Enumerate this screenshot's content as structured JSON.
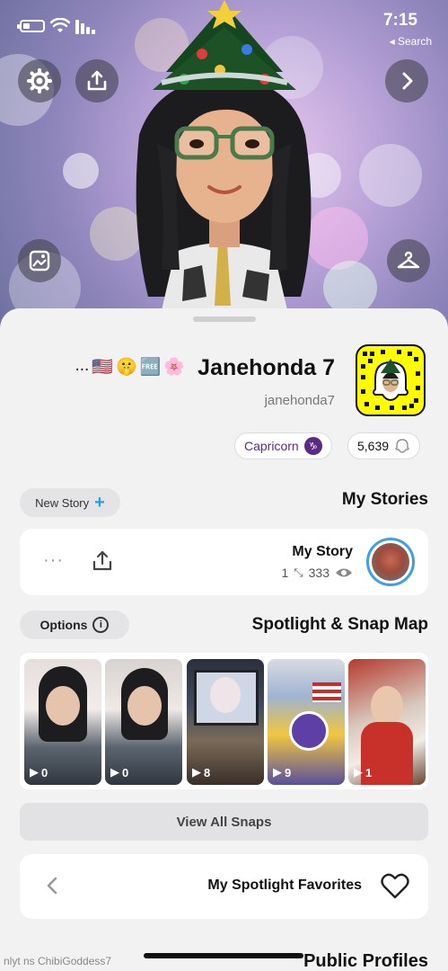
{
  "status_bar": {
    "time": "7:15",
    "back_label": "◂ Search"
  },
  "profile": {
    "display_name": "Janehonda 7",
    "username": "janehonda7",
    "emojis": [
      "🌸",
      "🆓",
      "🤫",
      "🇺🇸",
      "..."
    ],
    "score": "5,639",
    "zodiac": "Capricorn"
  },
  "my_stories": {
    "title": "My Stories",
    "new_story_label": "New Story",
    "story": {
      "title": "My Story",
      "views": "333",
      "screenshots": "1",
      "more": "···"
    }
  },
  "spotlight": {
    "title": "Spotlight & Snap Map",
    "options_label": "Options",
    "thumbnails": [
      {
        "count": "1"
      },
      {
        "count": "9"
      },
      {
        "count": "8"
      },
      {
        "count": "0"
      },
      {
        "count": "0"
      }
    ],
    "view_all_label": "View All Snaps"
  },
  "favorites": {
    "label": "My Spotlight Favorites"
  },
  "public_profiles": {
    "title": "Public Profiles",
    "subtitle": "nlyt  ns ChibiGoddess7"
  },
  "colors": {
    "snap_yellow": "#fffc00",
    "sheet_bg": "#f2f2f2",
    "accent_blue": "#1da1f2",
    "zodiac_purple": "#5b2a86"
  }
}
